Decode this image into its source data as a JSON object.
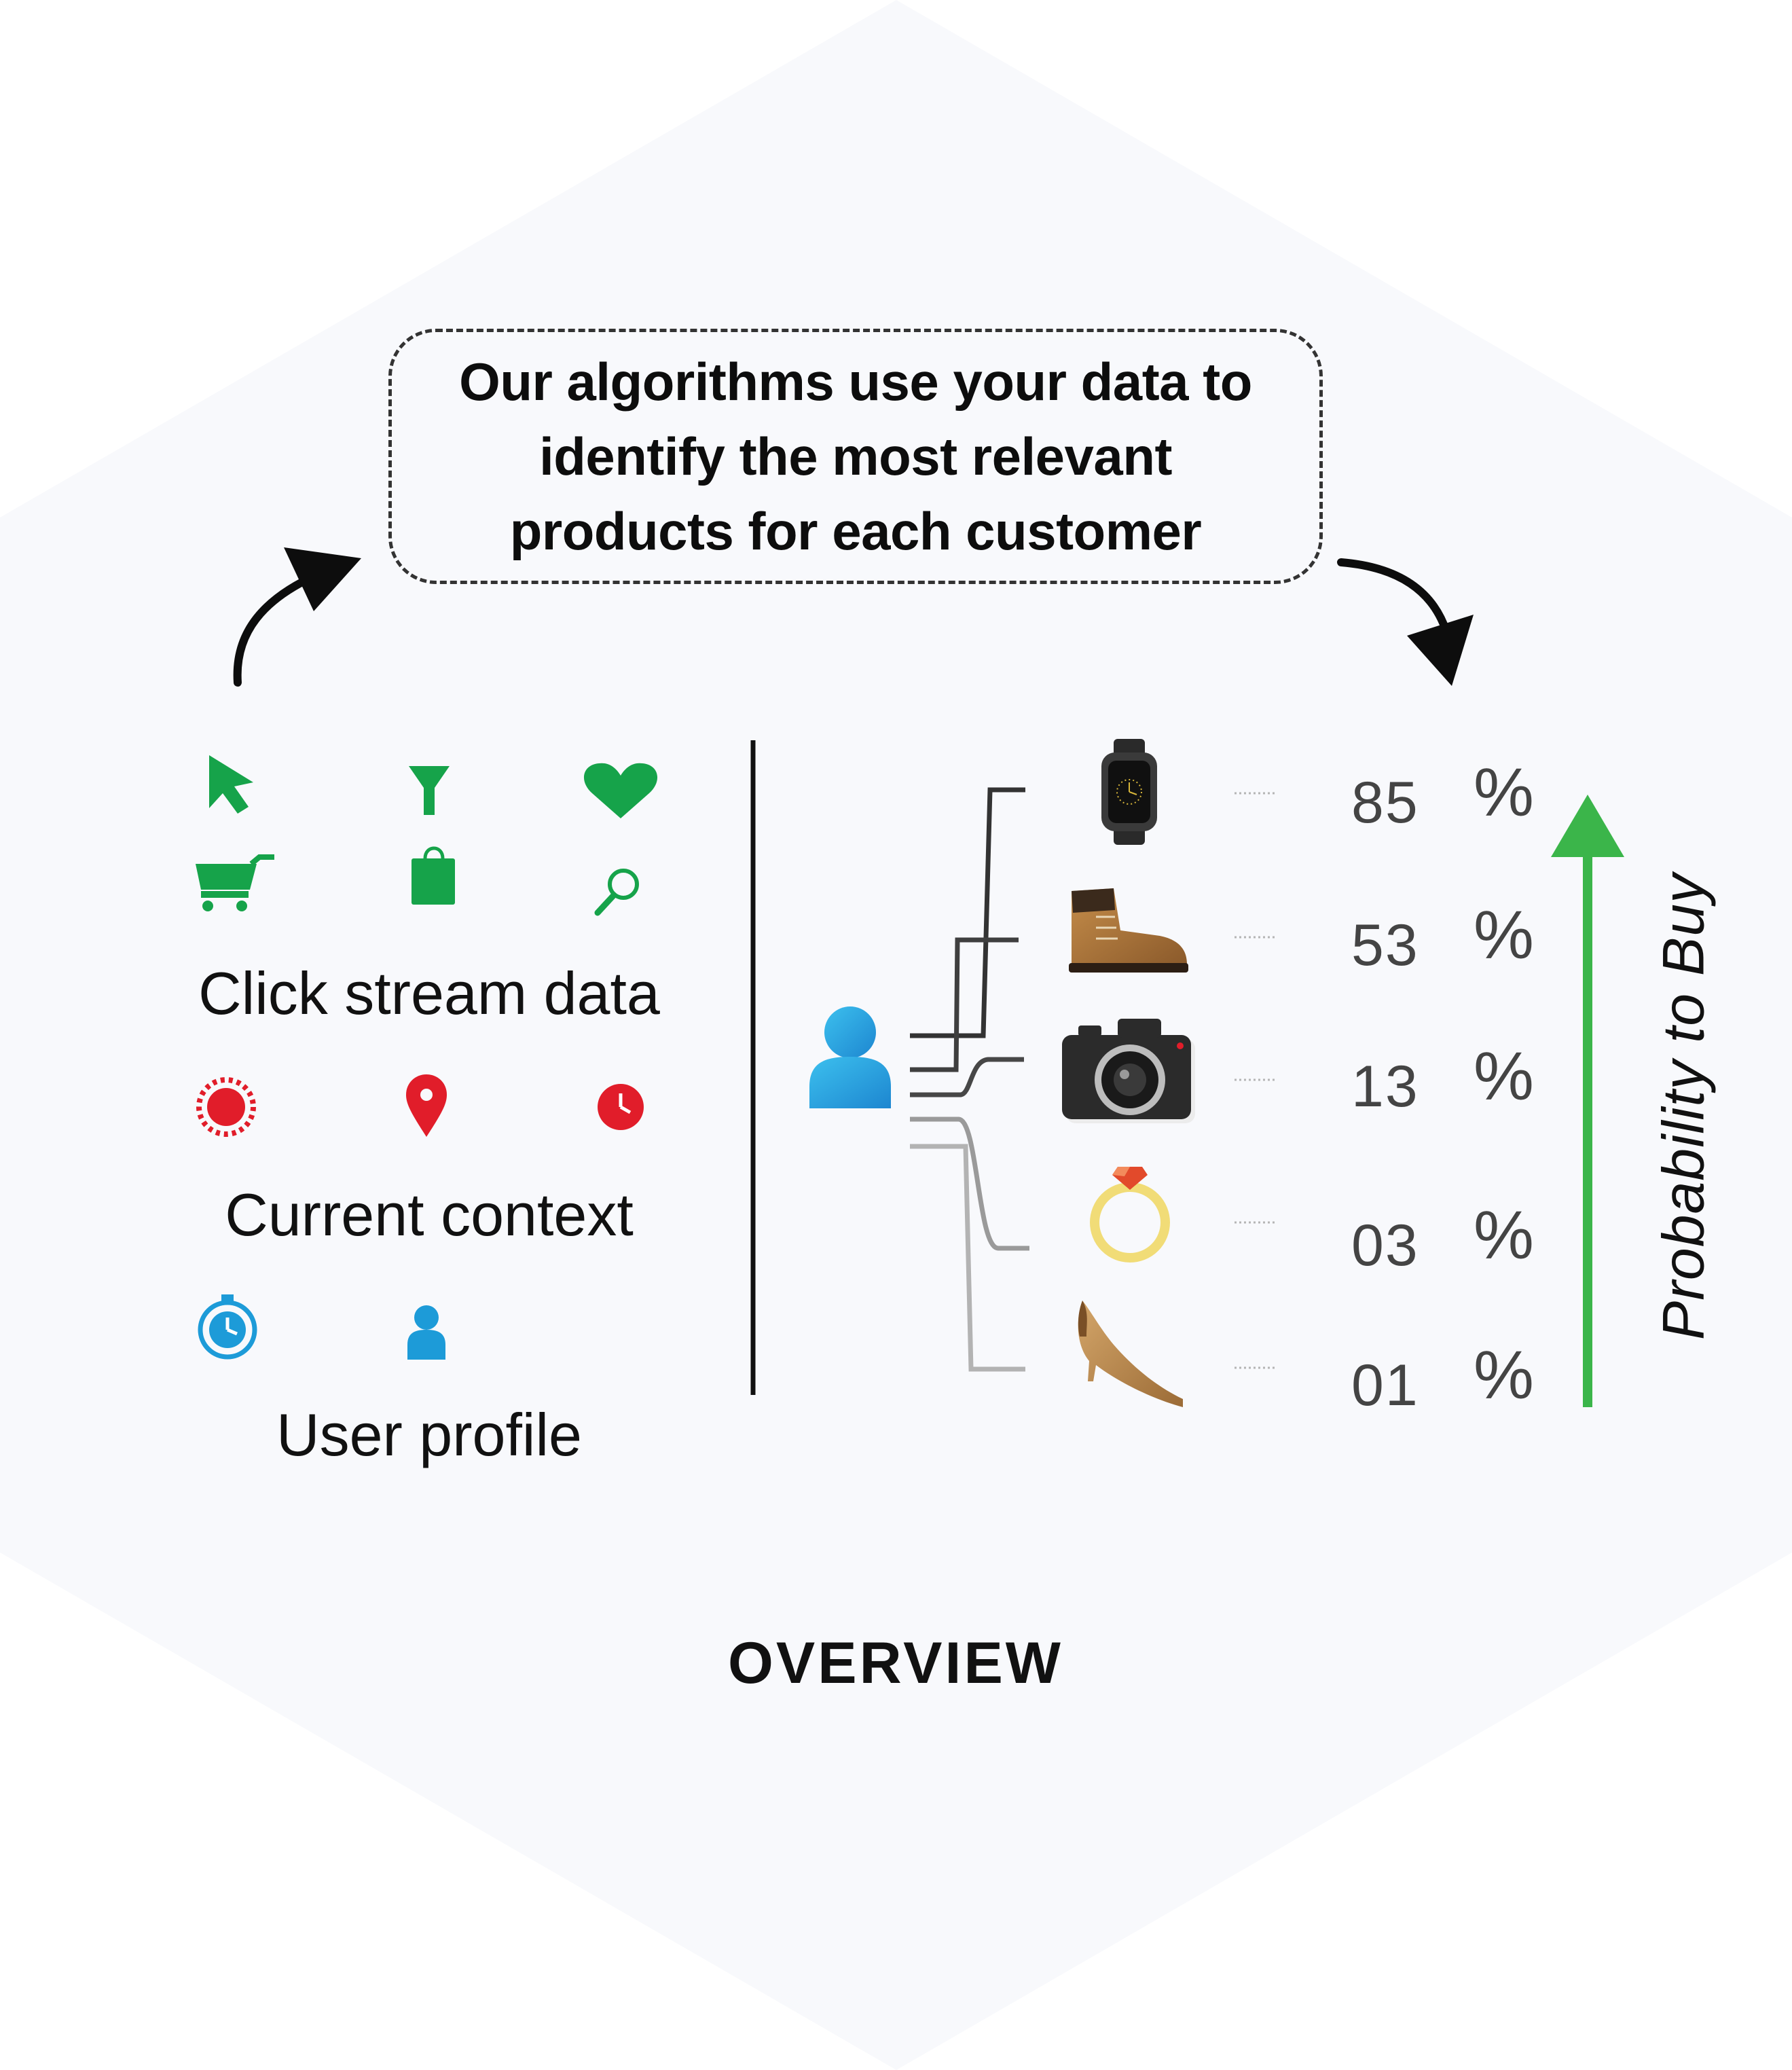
{
  "callout": {
    "text": "Our algorithms use your data to\nidentify the most relevant\nproducts for each customer"
  },
  "groups": [
    {
      "label": "Click stream data",
      "icons": [
        "cursor-arrow-icon",
        "funnel-icon",
        "heart-icon",
        "shopping-cart-icon",
        "shopping-bag-icon",
        "magnifier-icon"
      ],
      "color": "#16a34a"
    },
    {
      "label": "Current context",
      "icons": [
        "sun-icon",
        "location-pin-icon",
        "clock-icon"
      ],
      "color": "#e11d2a"
    },
    {
      "label": "User profile",
      "icons": [
        "stopwatch-icon",
        "person-icon"
      ],
      "color": "#1d9bd8"
    }
  ],
  "products": [
    {
      "icon": "smartwatch-icon",
      "percent": "85",
      "sign": "%"
    },
    {
      "icon": "boot-icon",
      "percent": "53",
      "sign": "%"
    },
    {
      "icon": "camera-icon",
      "percent": "13",
      "sign": "%"
    },
    {
      "icon": "ring-icon",
      "percent": "03",
      "sign": "%"
    },
    {
      "icon": "high-heel-icon",
      "percent": "01",
      "sign": "%"
    }
  ],
  "axis": {
    "label": "Probability to Buy",
    "arrow_color": "#3bb54a"
  },
  "title": "OVERVIEW",
  "colors": {
    "background_hexagon": "#f8f9fc",
    "customer_icon": "#29a9e0"
  }
}
